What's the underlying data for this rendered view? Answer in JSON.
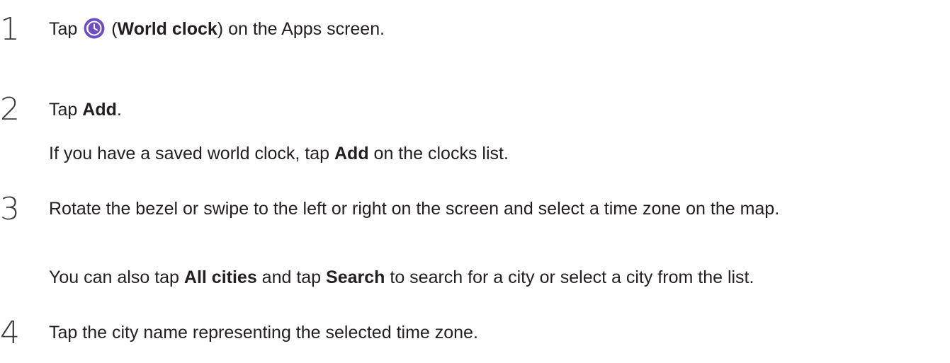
{
  "steps": [
    {
      "number": "1",
      "line1": {
        "pre": "Tap ",
        "icon": "world-clock-app-icon",
        "paren_open": " (",
        "bold": "World clock",
        "post": ") on the Apps screen."
      }
    },
    {
      "number": "2",
      "line1": {
        "pre": "Tap ",
        "bold": "Add",
        "post": "."
      },
      "note": {
        "pre": "If you have a saved world clock, tap ",
        "bold": "Add",
        "post": " on the clocks list."
      }
    },
    {
      "number": "3",
      "line1": {
        "text": "Rotate the bezel or swipe to the left or right on the screen and select a time zone on the map."
      },
      "note": {
        "pre": "You can also tap ",
        "bold1": "All cities",
        "mid": " and tap ",
        "bold2": "Search",
        "post": " to search for a city or select a city from the list."
      }
    },
    {
      "number": "4",
      "line1": {
        "text": "Tap the city name representing the selected time zone."
      }
    }
  ],
  "colors": {
    "icon_bg": "#6d4fc2",
    "text": "#231f20"
  }
}
